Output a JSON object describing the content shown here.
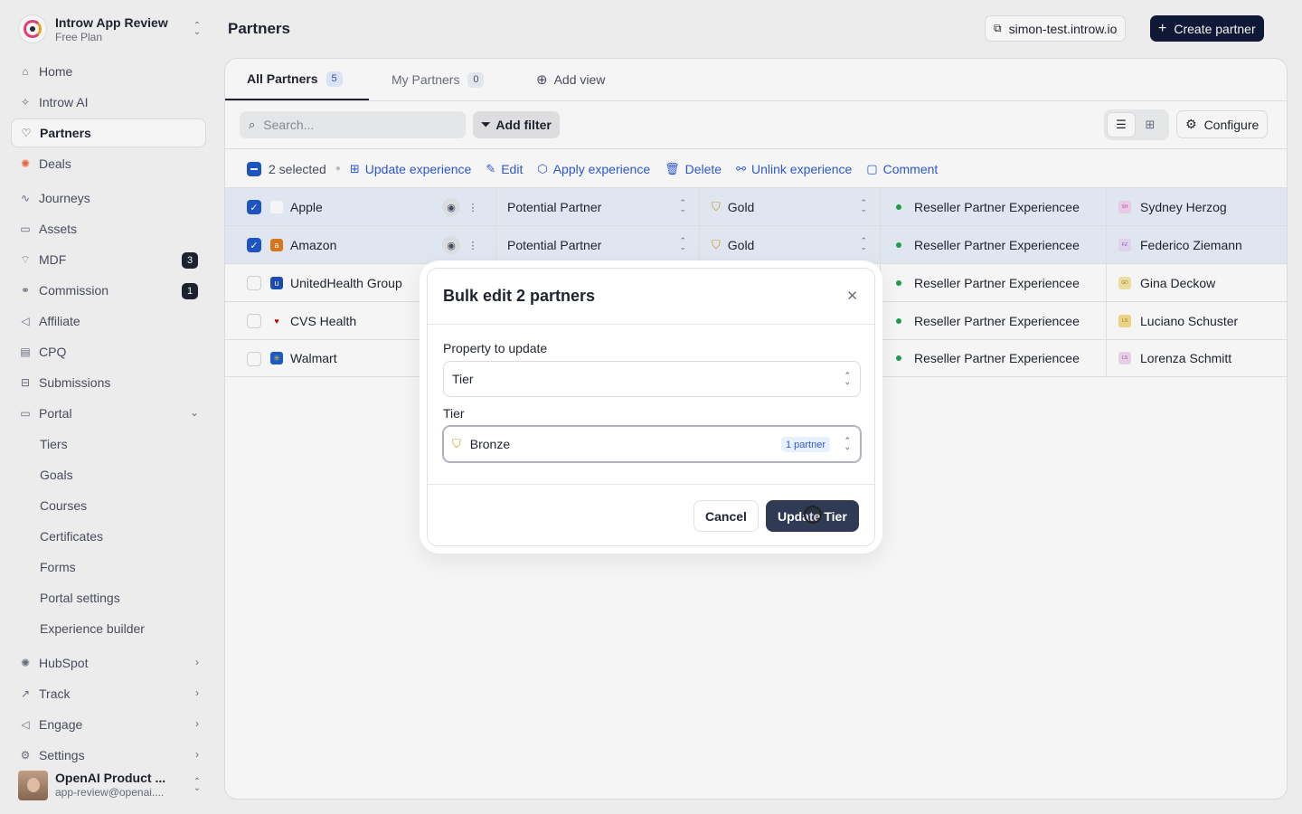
{
  "workspace": {
    "name": "Introw App Review",
    "plan": "Free Plan"
  },
  "nav": {
    "home": "Home",
    "ai": "Introw AI",
    "partners": "Partners",
    "deals": "Deals",
    "journeys": "Journeys",
    "assets": "Assets",
    "mdf": "MDF",
    "mdf_badge": "3",
    "commission": "Commission",
    "commission_badge": "1",
    "affiliate": "Affiliate",
    "cpq": "CPQ",
    "submissions": "Submissions",
    "portal": "Portal",
    "portal_sub": [
      "Tiers",
      "Goals",
      "Courses",
      "Certificates",
      "Forms",
      "Portal settings",
      "Experience builder"
    ],
    "hubspot": "HubSpot",
    "track": "Track",
    "engage": "Engage",
    "settings": "Settings"
  },
  "user": {
    "name": "OpenAI Product ...",
    "email": "app-review@openai...."
  },
  "header": {
    "title": "Partners",
    "domain": "simon-test.introw.io",
    "create_label": "Create partner"
  },
  "tabs": [
    {
      "label": "All Partners",
      "count": "5"
    },
    {
      "label": "My Partners",
      "count": "0"
    }
  ],
  "add_view": "Add view",
  "toolbar": {
    "search_placeholder": "Search...",
    "filter_label": "Add filter",
    "configure_label": "Configure"
  },
  "selection": {
    "count_text": "2 selected",
    "actions": [
      "Update experience",
      "Edit",
      "Apply experience",
      "Delete",
      "Unlink experience",
      "Comment"
    ]
  },
  "rows": [
    {
      "name": "Apple",
      "status": "Potential Partner",
      "tier": "Gold",
      "experience": "Reseller Partner Experiencee",
      "owner": "Sydney Herzog",
      "owner_initials": "SH",
      "selected": true
    },
    {
      "name": "Amazon",
      "status": "Potential Partner",
      "tier": "Gold",
      "experience": "Reseller Partner Experiencee",
      "owner": "Federico Ziemann",
      "owner_initials": "FZ",
      "selected": true
    },
    {
      "name": "UnitedHealth Group",
      "experience": "Reseller Partner Experiencee",
      "owner": "Gina Deckow",
      "owner_initials": "GD",
      "selected": false
    },
    {
      "name": "CVS Health",
      "experience": "Reseller Partner Experiencee",
      "owner": "Luciano Schuster",
      "owner_initials": "LS",
      "selected": false
    },
    {
      "name": "Walmart",
      "experience": "Reseller Partner Experiencee",
      "owner": "Lorenza Schmitt",
      "owner_initials": "LS",
      "selected": false
    }
  ],
  "modal": {
    "title": "Bulk edit 2 partners",
    "property_label": "Property to update",
    "property_value": "Tier",
    "tier_label": "Tier",
    "tier_value": "Bronze",
    "tier_pill": "1 partner",
    "cancel_label": "Cancel",
    "update_label": "Update Tier"
  },
  "colors": {
    "accent": "#2f5bd6",
    "primary_dark": "#111a3a",
    "selected_row": "#eaf0fa",
    "active_dot": "#20a34b",
    "tier_shield": "#d79a2a"
  }
}
